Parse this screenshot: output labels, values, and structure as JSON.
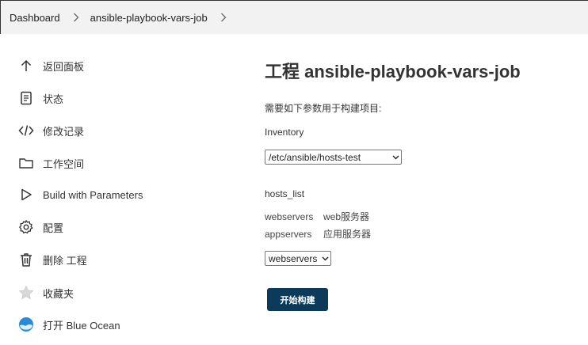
{
  "breadcrumb": {
    "items": [
      {
        "label": "Dashboard"
      },
      {
        "label": "ansible-playbook-vars-job"
      }
    ]
  },
  "sidebar": {
    "items": [
      {
        "label": "返回面板",
        "icon": "arrow-up-icon"
      },
      {
        "label": "状态",
        "icon": "document-icon"
      },
      {
        "label": "修改记录",
        "icon": "code-icon"
      },
      {
        "label": "工作空间",
        "icon": "folder-icon"
      },
      {
        "label": "Build with Parameters",
        "icon": "play-icon"
      },
      {
        "label": "配置",
        "icon": "gear-icon"
      },
      {
        "label": "删除 工程",
        "icon": "trash-icon"
      },
      {
        "label": "收藏夹",
        "icon": "star-icon"
      },
      {
        "label": "打开 Blue Ocean",
        "icon": "blue-ocean-icon"
      }
    ]
  },
  "main": {
    "title": "工程 ansible-playbook-vars-job",
    "params_description": "需要如下参数用于构建项目:",
    "inventory": {
      "name": "Inventory",
      "selected": "/etc/ansible/hosts-test"
    },
    "hosts_list": {
      "name": "hosts_list",
      "options_description": [
        {
          "key": "webservers",
          "value": "web服务器"
        },
        {
          "key": "appservers",
          "value": "应用服务器"
        }
      ],
      "selected": "webservers"
    },
    "build_button": "开始构建"
  },
  "colors": {
    "button_bg": "#0b3a5a",
    "breadcrumb_bg": "#f2f2f2",
    "blue_ocean": "#2a8ad8"
  }
}
